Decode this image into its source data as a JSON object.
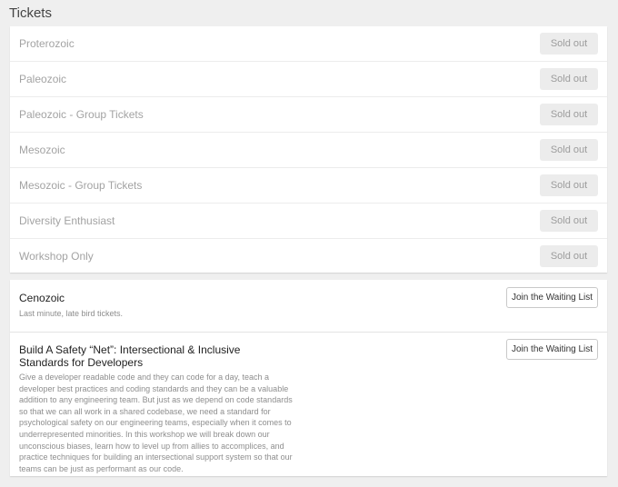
{
  "page": {
    "title": "Tickets"
  },
  "sold_out_tickets": [
    {
      "name": "Proterozoic",
      "button": "Sold out"
    },
    {
      "name": "Paleozoic",
      "button": "Sold out"
    },
    {
      "name": "Paleozoic - Group Tickets",
      "button": "Sold out"
    },
    {
      "name": "Mesozoic",
      "button": "Sold out"
    },
    {
      "name": "Mesozoic - Group Tickets",
      "button": "Sold out"
    },
    {
      "name": "Diversity Enthusiast",
      "button": "Sold out"
    },
    {
      "name": "Workshop Only",
      "button": "Sold out"
    }
  ],
  "waitlist_tickets": [
    {
      "name": "Cenozoic",
      "description": "Last minute, late bird tickets.",
      "button": "Join the Waiting List"
    },
    {
      "name": "Build A Safety “Net”: Intersectional & Inclusive Standards for Developers",
      "description": "Give a developer readable code and they can code for a day, teach a developer best practices and coding standards and they can be a valuable addition to any engineering team. But just as we depend on code standards so that we can all work in a shared codebase, we need a standard for psychological safety on our engineering teams, especially when it comes to underrepresented minorities. In this workshop we will break down our unconscious biases, learn how to level up from allies to accomplices, and practice techniques for building an intersectional support system so that our teams can be just as performant as our code.",
      "button": "Join the Waiting List"
    }
  ],
  "colors": {
    "background": "#efefef",
    "panel": "#ffffff",
    "soldout_button_bg": "#ececec",
    "muted_text": "#a3a3a3"
  }
}
